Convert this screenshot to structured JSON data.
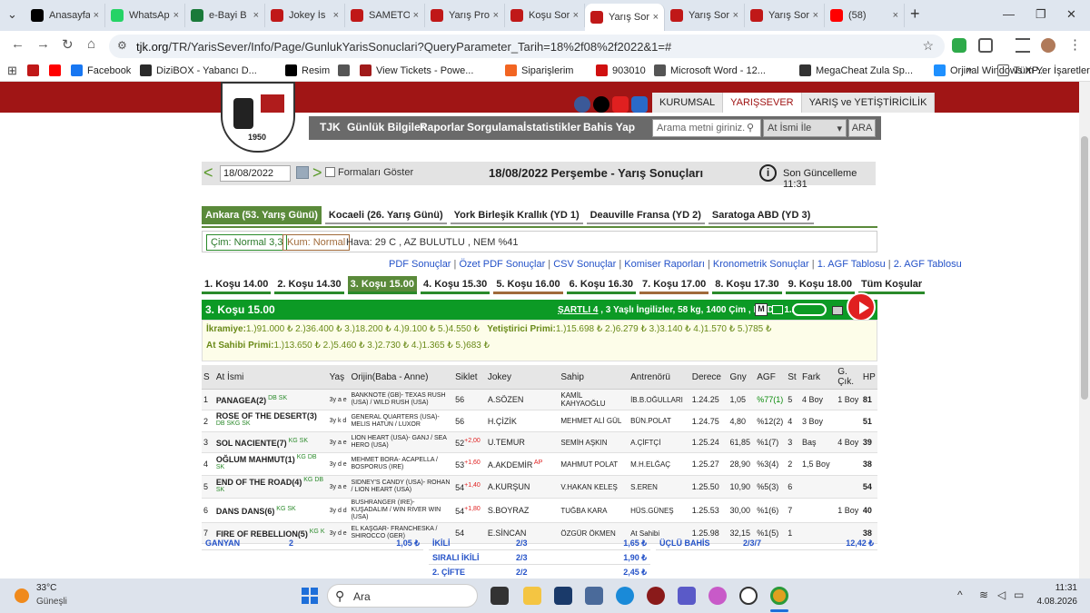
{
  "browser": {
    "tabs": [
      {
        "label": "Anasayfa",
        "icon": "x-logo-icon",
        "color": "#000000"
      },
      {
        "label": "WhatsApp",
        "icon": "whatsapp-icon",
        "color": "#25d366"
      },
      {
        "label": "e-Bayi B",
        "icon": "horse-logo-icon",
        "color": "#1a7a3a"
      },
      {
        "label": "Jokey İs",
        "icon": "tjk-logo-icon",
        "color": "#c01818"
      },
      {
        "label": "SAMETO",
        "icon": "tjk-logo-icon",
        "color": "#c01818"
      },
      {
        "label": "Yarış Pro",
        "icon": "tjk-logo-icon",
        "color": "#c01818"
      },
      {
        "label": "Koşu Sor",
        "icon": "tjk-logo-icon",
        "color": "#c01818"
      },
      {
        "label": "Yarış Sor",
        "icon": "tjk-logo-icon",
        "color": "#c01818"
      },
      {
        "label": "Yarış Sor",
        "icon": "tjk-logo-icon",
        "color": "#c01818"
      },
      {
        "label": "Yarış Sor",
        "icon": "tjk-logo-icon",
        "color": "#c01818"
      },
      {
        "label": "(58)",
        "icon": "youtube-icon",
        "color": "#ff0000"
      }
    ],
    "new_tab": "+",
    "url_host": "tjk.org",
    "url_path": "/TR/YarisSever/Info/Page/GunlukYarisSonuclari?QueryParameter_Tarih=18%2f08%2f2022&1=#",
    "bookmarks": [
      {
        "label": "",
        "icon": "tjk-icon",
        "color": "#c01818"
      },
      {
        "label": "",
        "icon": "youtube-icon",
        "color": "#ff0000"
      },
      {
        "label": "Facebook",
        "icon": "facebook-icon",
        "color": "#1877f2"
      },
      {
        "label": "DiziBOX - Yabancı D...",
        "icon": "dizibox-icon",
        "color": "#2a2a2a"
      },
      {
        "label": "Resim",
        "icon": "x-icon",
        "color": "#000000"
      },
      {
        "label": "",
        "icon": "globe-icon",
        "color": "#555555"
      },
      {
        "label": "View Tickets - Powe...",
        "icon": "ticket-icon",
        "color": "#a01a1a"
      },
      {
        "label": "Siparişlerim",
        "icon": "mp-icon",
        "color": "#f26522"
      },
      {
        "label": "903010",
        "icon": "dp-icon",
        "color": "#d01010"
      },
      {
        "label": "Microsoft Word - 12...",
        "icon": "globe-icon",
        "color": "#555555"
      },
      {
        "label": "MegaCheat Zula Sp...",
        "icon": "megacheat-icon",
        "color": "#333333"
      },
      {
        "label": "Orjinal Windows XP...",
        "icon": "windows-icon",
        "color": "#1e90ff"
      }
    ],
    "bookmarks_more": "»",
    "all_bookmarks": "Tüm Yer İşaretleri"
  },
  "site": {
    "logo_year": "1950",
    "top_nav": [
      "KURUMSAL",
      "YARIŞSEVER",
      "YARIŞ ve YETİŞTİRİCİLİK"
    ],
    "main_menu": [
      "TJK",
      "Günlük Bilgiler",
      "Raporlar",
      "Sorgulama",
      "İstatistikler",
      "Bahis Yap"
    ],
    "search_placeholder": "Arama metni giriniz.",
    "search_select": "At İsmi İle",
    "search_button": "ARA"
  },
  "datebar": {
    "date": "18/08/2022",
    "show_forms": "Formaları Göster",
    "title": "18/08/2022 Perşembe - Yarış Sonuçları",
    "last_update": "Son Güncelleme 11:31"
  },
  "hippodromes": [
    "Ankara (53. Yarış Günü)",
    "Kocaeli (26. Yarış Günü)",
    "York Birleşik Krallık (YD 1)",
    "Deauville Fransa (YD 2)",
    "Saratoga ABD (YD 3)"
  ],
  "conditions": {
    "turf": "Çim: Normal 3,3",
    "dirt": "Kum: Normal",
    "weather": "Hava: 29 C , AZ BULUTLU , NEM %41"
  },
  "links": [
    "PDF Sonuçlar",
    "Özet PDF Sonuçlar",
    "CSV Sonuçlar",
    "Komiser Raporları",
    "Kronometrik Sonuçlar",
    "1. AGF Tablosu",
    "2. AGF Tablosu"
  ],
  "races": [
    "1. Koşu 14.00",
    "2. Koşu 14.30",
    "3. Koşu 15.00",
    "4. Koşu 15.30",
    "5. Koşu 16.00",
    "6. Koşu 16.30",
    "7. Koşu 17.00",
    "8. Koşu 17.30",
    "9. Koşu 18.00",
    "Tüm Koşular"
  ],
  "race_colors": [
    "#2a8a2a",
    "#2a8a2a",
    "#2a8a2a",
    "#2a8a2a",
    "#a06a3a",
    "#2a8a2a",
    "#a06a3a",
    "#2a8a2a",
    "#2a8a2a",
    "#2a8a2a"
  ],
  "race_header": {
    "title": "3. Koşu 15.00",
    "condition_type": "ŞARTLI 4",
    "condition_rest": " , 3 Yaşlı İngilizler, 58 kg, 1400 Çim , E.İ.D. : 1.21.74"
  },
  "prizes": {
    "ikramiye_label": "İkramiye:",
    "ikramiye": "1.)91.000 ₺  2.)36.400 ₺  3.)18.200 ₺  4.)9.100 ₺  5.)4.550 ₺",
    "yetistirici_label": "Yetiştirici Primi:",
    "yetistirici": "1.)15.698 ₺  2.)6.279 ₺  3.)3.140 ₺  4.)1.570 ₺  5.)785 ₺",
    "atsahibi_label": "At Sahibi Primi:",
    "atsahibi": "1.)13.650 ₺  2.)5.460 ₺  3.)2.730 ₺  4.)1.365 ₺  5.)683 ₺"
  },
  "table": {
    "headers": [
      "S",
      "At İsmi",
      "Yaş",
      "Orijin(Baba - Anne)",
      "Siklet",
      "Jokey",
      "Sahip",
      "Antrenörü",
      "Derece",
      "Gny",
      "AGF",
      "St",
      "Fark",
      "G. Çık.",
      "HP"
    ],
    "rows": [
      {
        "s": "1",
        "name": "PANAGEA(2)",
        "tags": "DB SK",
        "yas": "3y a e",
        "origin": "BANKNOTE (GB)- TEXAS RUSH (USA) / WILD RUSH (USA)",
        "kg": "56",
        "kgx": "",
        "jokey": "A.SÖZEN",
        "jx": "",
        "sahip": "KAMİL KAHYAOĞLU",
        "antr": "İB.B.OĞULLARI",
        "derece": "1.24.25",
        "gny": "1,05",
        "agf": "%77(1)",
        "st": "5",
        "fark": "4 Boy",
        "gcik": "1 Boy",
        "hp": "81"
      },
      {
        "s": "2",
        "name": "ROSE OF THE DESERT(3)",
        "tags": "DB SKG SK",
        "yas": "3y k d",
        "origin": "GENERAL QUARTERS (USA)- MELIS HATUN / LUXOR",
        "kg": "56",
        "kgx": "",
        "jokey": "H.ÇİZİK",
        "jx": "",
        "sahip": "MEHMET ALİ GÜL",
        "antr": "BÜN.POLAT",
        "derece": "1.24.75",
        "gny": "4,80",
        "agf": "%12(2)",
        "st": "4",
        "fark": "3 Boy",
        "gcik": "",
        "hp": "51"
      },
      {
        "s": "3",
        "name": "SOL NACIENTE(7)",
        "tags": "KG SK",
        "yas": "3y a e",
        "origin": "LION HEART (USA)- GANJ / SEA HERO (USA)",
        "kg": "52",
        "kgx": "+2,00",
        "jokey": "U.TEMUR",
        "jx": "",
        "sahip": "SEMİH AŞKIN",
        "antr": "A.ÇİFTÇİ",
        "derece": "1.25.24",
        "gny": "61,85",
        "agf": "%1(7)",
        "st": "3",
        "fark": "Baş",
        "gcik": "4 Boy",
        "hp": "39"
      },
      {
        "s": "4",
        "name": "OĞLUM MAHMUT(1)",
        "tags": "KG DB SK",
        "yas": "3y d e",
        "origin": "MEHMET BORA- ACAPELLA / BOSPORUS (IRE)",
        "kg": "53",
        "kgx": "+1,60",
        "jokey": "A.AKDEMİR",
        "jx": "AP",
        "sahip": "MAHMUT POLAT",
        "antr": "M.H.ELĞAÇ",
        "derece": "1.25.27",
        "gny": "28,90",
        "agf": "%3(4)",
        "st": "2",
        "fark": "1,5 Boy",
        "gcik": "",
        "hp": "38"
      },
      {
        "s": "5",
        "name": "END OF THE ROAD(4)",
        "tags": "KG DB SK",
        "yas": "3y a e",
        "origin": "SIDNEY'S CANDY (USA)- ROHAN / LION HEART (USA)",
        "kg": "54",
        "kgx": "+1,40",
        "jokey": "A.KURŞUN",
        "jx": "",
        "sahip": "V.HAKAN KELEŞ",
        "antr": "S.EREN",
        "derece": "1.25.50",
        "gny": "10,90",
        "agf": "%5(3)",
        "st": "6",
        "fark": "",
        "gcik": "",
        "hp": "54"
      },
      {
        "s": "6",
        "name": "DANS DANS(6)",
        "tags": "KG SK",
        "yas": "3y d d",
        "origin": "BUSHRANGER (IRE)- KUŞADALIM / WIN RIVER WIN (USA)",
        "kg": "54",
        "kgx": "+1,80",
        "jokey": "S.BOYRAZ",
        "jx": "",
        "sahip": "TUĞBA KARA",
        "antr": "HÜS.GÜNEŞ",
        "derece": "1.25.53",
        "gny": "30,00",
        "agf": "%1(6)",
        "st": "7",
        "fark": "",
        "gcik": "1 Boy",
        "hp": "40"
      },
      {
        "s": "7",
        "name": "FIRE OF REBELLION(5)",
        "tags": "KG K",
        "yas": "3y d e",
        "origin": "EL KAŞGAR- FRANCHESKA / SHIROCCO (GER)",
        "kg": "54",
        "kgx": "",
        "jokey": "E.SİNCAN",
        "jx": "",
        "sahip": "ÖZGÜR ÖKMEN",
        "antr": "At Sahibi",
        "derece": "1.25.98",
        "gny": "32,15",
        "agf": "%1(5)",
        "st": "1",
        "fark": "",
        "gcik": "",
        "hp": "38"
      }
    ]
  },
  "bets": {
    "ganyan": {
      "label": "GANYAN",
      "combo": "2",
      "value": "1,05 ₺"
    },
    "ikili": {
      "label": "İKİLİ",
      "combo": "2/3",
      "value": "1,65 ₺"
    },
    "sirali": {
      "label": "SIRALI İKİLİ",
      "combo": "2/3",
      "value": "1,90 ₺"
    },
    "cifte": {
      "label": "2. ÇİFTE",
      "combo": "2/2",
      "value": "2,45 ₺"
    },
    "uclu": {
      "label": "ÜÇLÜ BAHİS",
      "combo": "2/3/7",
      "value": "12,42 ₺"
    }
  },
  "taskbar": {
    "temp": "33°C",
    "weather": "Güneşli",
    "search": "Ara",
    "time": "11:31",
    "date": "4.08.2026"
  }
}
